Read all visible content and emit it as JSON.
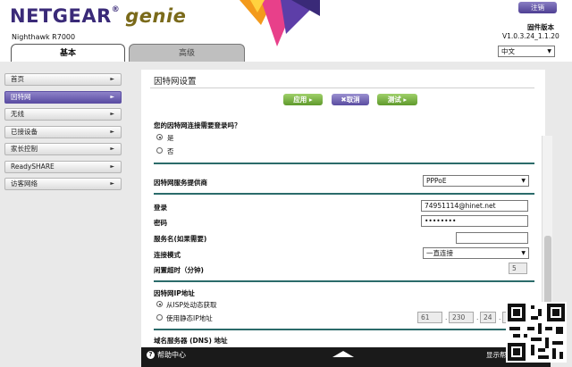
{
  "brand": {
    "name": "NETGEAR",
    "reg_mark": "®",
    "product": "genie",
    "model": "Nighthawk R7000"
  },
  "header": {
    "logout_label": "注销",
    "firmware_label": "固件版本",
    "firmware_version": "V1.0.3.24_1.1.20",
    "language": "中文"
  },
  "tabs": [
    {
      "label": "基本",
      "active": true
    },
    {
      "label": "高级",
      "active": false
    }
  ],
  "sidebar": {
    "items": [
      {
        "label": "首页",
        "active": false
      },
      {
        "label": "因特网",
        "active": true
      },
      {
        "label": "无线",
        "active": false
      },
      {
        "label": "已接设备",
        "active": false
      },
      {
        "label": "家长控制",
        "active": false
      },
      {
        "label": "ReadySHARE",
        "active": false
      },
      {
        "label": "访客网络",
        "active": false
      }
    ]
  },
  "page": {
    "title": "因特网设置",
    "buttons": {
      "apply": "应用 ▸",
      "cancel": "✖取消",
      "test": "测试 ▸"
    },
    "login_question": "您的因特网连接需要登录吗？",
    "login_yes": "是",
    "login_no": "否",
    "isp_label": "因特网服务提供商",
    "isp_value": "PPPoE",
    "login_label": "登录",
    "login_value": "74951114@hinet.net",
    "password_label": "密码",
    "password_value": "••••••••",
    "service_label": "服务名(如果需要)",
    "service_value": "",
    "conn_mode_label": "连接模式",
    "conn_mode_value": "一直连接",
    "idle_label": "闲置超时（分钟)",
    "idle_value": "5",
    "ip_section_label": "因特网IP地址",
    "ip_dynamic": "从ISP处动态获取",
    "ip_static": "使用静态IP地址",
    "ip_octets": [
      "61",
      "230",
      "24",
      ""
    ],
    "dns_label": "域名服务器 (DNS) 地址"
  },
  "footer": {
    "help_label": "帮助中心",
    "right_label": "显示帮助中心"
  },
  "colors": {
    "brand_purple": "#3a2a78",
    "accent_purple": "#5c4ea3",
    "apply_green": "#5f9a2c",
    "rule_teal": "#2b6b6a"
  }
}
